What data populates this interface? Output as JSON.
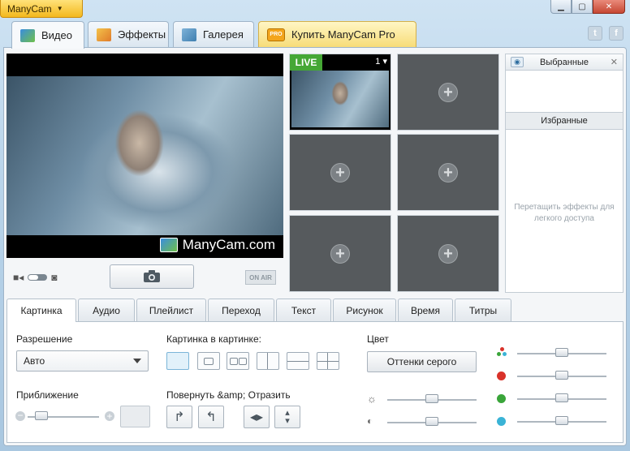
{
  "app": {
    "menu_label": "ManyCam"
  },
  "top_tabs": [
    {
      "label": "Видео"
    },
    {
      "label": "Эффекты"
    },
    {
      "label": "Галерея"
    },
    {
      "label": "Купить ManyCam Pro"
    }
  ],
  "pro_badge": "PRO",
  "social": {
    "twitter": "t",
    "facebook": "f"
  },
  "video": {
    "watermark": "ManyCam.com"
  },
  "controls": {
    "on_air": "ON AIR"
  },
  "sources": {
    "live_label": "LIVE",
    "live_number": "1"
  },
  "favorites": {
    "header": "Выбранные",
    "sub_header": "Избранные",
    "hint": "Перетащить эффекты для легкого доступа"
  },
  "bottom_tabs": [
    {
      "label": "Картинка"
    },
    {
      "label": "Аудио"
    },
    {
      "label": "Плейлист"
    },
    {
      "label": "Переход"
    },
    {
      "label": "Текст"
    },
    {
      "label": "Рисунок"
    },
    {
      "label": "Время"
    },
    {
      "label": "Титры"
    }
  ],
  "settings": {
    "resolution_label": "Разрешение",
    "resolution_value": "Авто",
    "zoom_label": "Приближение",
    "pip_label": "Картинка в картинке:",
    "rotate_label": "Повернуть &amp; Отразить",
    "color_label": "Цвет",
    "grayscale_button": "Оттенки серого",
    "zoom_level": 0.1,
    "brightness_level": 0.5,
    "contrast_level": 0.5,
    "saturation_level": 0.5,
    "red_level": 0.5,
    "green_level": 0.5,
    "blue_level": 0.5
  },
  "colors": {
    "live_green": "#45a735",
    "red": "#d9322a",
    "green": "#3aa53a",
    "blue": "#3ab3d6",
    "pro_gold": "#f3a51c"
  }
}
